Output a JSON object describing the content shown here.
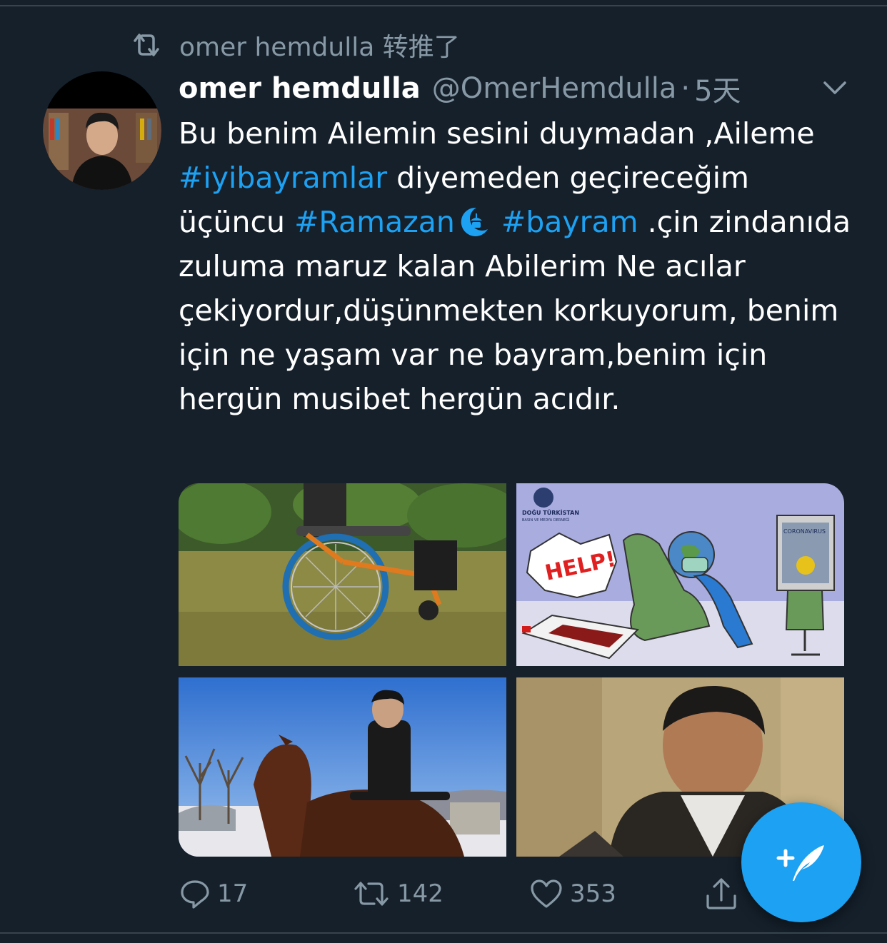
{
  "retweet_bar": {
    "text": "omer hemdulla 转推了",
    "icon": "retweet-icon"
  },
  "tweet": {
    "author_name": "omer hemdulla",
    "author_handle": "@OmerHemdulla",
    "separator": "·",
    "time": "5天",
    "text_parts": {
      "p1": "Bu benim Ailemin sesini duymadan ,Aileme ",
      "tag1": "#iyibayramlar",
      "p2": " diyemeden geçireceğim üçüncu ",
      "tag2": "#Ramazan",
      "p3": "  ",
      "tag3": "#bayram",
      "p4": " .çin zindanıda zuluma maruz kalan Abilerim Ne acılar çekiyordur,düşünmekten korkuyorum, benim için ne yaşam var ne bayram,benim için hergün musibet hergün acıdır."
    },
    "media": [
      {
        "kind": "photo",
        "subject": "wheelchair on grass"
      },
      {
        "kind": "cartoon",
        "subject": "coronavirus cartoon",
        "texts": {
          "logo": "DOĞU TÜRKİSTAN",
          "logo_sub": "BASIN VE MEDYA DERNEĞİ",
          "help": "HELP!",
          "tv": "CORONAVIRUS"
        }
      },
      {
        "kind": "photo",
        "subject": "man riding horse"
      },
      {
        "kind": "photo",
        "subject": "man portrait"
      }
    ]
  },
  "actions": {
    "reply_count": "17",
    "retweet_count": "142",
    "like_count": "353"
  },
  "colors": {
    "background": "#15202b",
    "accent": "#1da1f2",
    "muted": "#8899a6",
    "divider": "#38444d"
  },
  "fab": {
    "icon": "compose-tweet-icon"
  }
}
